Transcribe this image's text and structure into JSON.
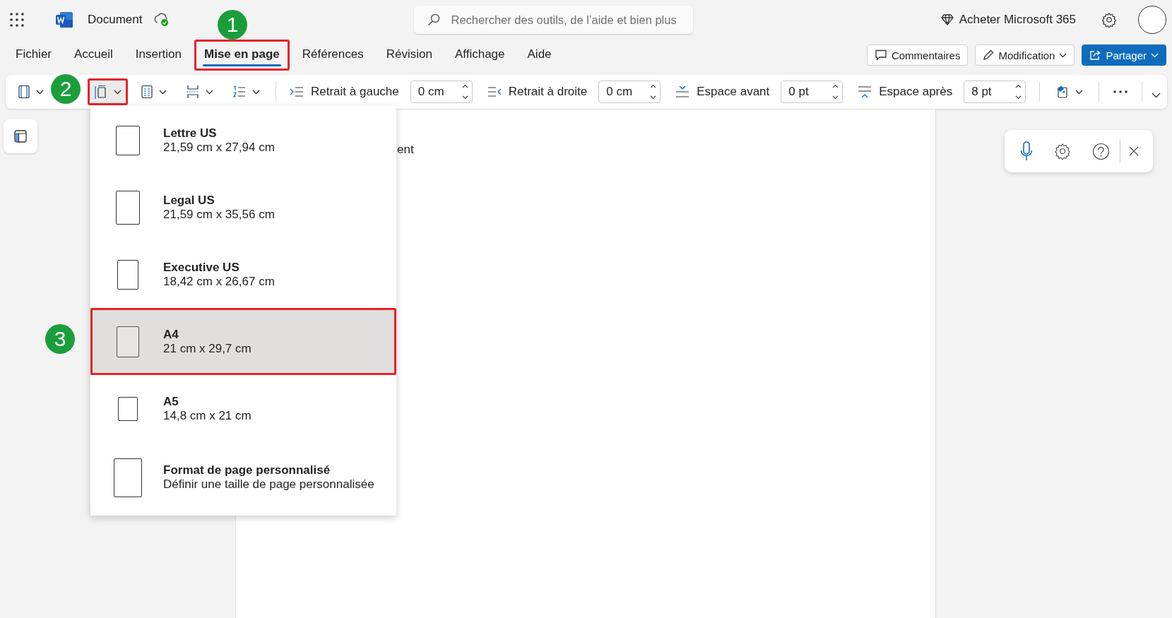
{
  "app_bar": {
    "document_title": "Document",
    "search": {
      "placeholder": "Rechercher des outils, de l’aide et bien plus"
    },
    "buy_label": "Acheter Microsoft 365"
  },
  "menu_tabs": [
    {
      "label": "Fichier",
      "selected": false,
      "outlined": false
    },
    {
      "label": "Accueil",
      "selected": false,
      "outlined": false
    },
    {
      "label": "Insertion",
      "selected": false,
      "outlined": false
    },
    {
      "label": "Mise en page",
      "selected": true,
      "outlined": true
    },
    {
      "label": "Références",
      "selected": false,
      "outlined": false
    },
    {
      "label": "Révision",
      "selected": false,
      "outlined": false
    },
    {
      "label": "Affichage",
      "selected": false,
      "outlined": false
    },
    {
      "label": "Aide",
      "selected": false,
      "outlined": false
    }
  ],
  "actions": [
    {
      "label": "Commentaires",
      "kind": "comment"
    },
    {
      "label": "Modification",
      "kind": "edit"
    },
    {
      "label": "Partager",
      "kind": "share"
    }
  ],
  "toolbar": {
    "tools": [
      {
        "kind": "margins",
        "outlined": false
      },
      {
        "kind": "size",
        "outlined": true
      },
      {
        "kind": "columns",
        "outlined": false
      },
      {
        "kind": "breaks",
        "outlined": false
      },
      {
        "kind": "line-numbers",
        "outlined": false
      }
    ],
    "spacing": [
      {
        "kind": "indent-left",
        "label": "Retrait à gauche",
        "value": "0 cm"
      },
      {
        "kind": "indent-right",
        "label": "Retrait à droite",
        "value": "0 cm"
      },
      {
        "kind": "space-before",
        "label": "Espace avant",
        "value": "0 pt"
      },
      {
        "kind": "space-after",
        "label": "Espace après",
        "value": "8 pt"
      }
    ]
  },
  "document": {
    "visible_text": "ent"
  },
  "page_sizes": [
    {
      "kind": "letter",
      "name": "Lettre US",
      "dimensions": "21,59 cm x 27,94 cm",
      "selected": false,
      "outlined": false
    },
    {
      "kind": "legal",
      "name": "Legal US",
      "dimensions": "21,59 cm x 35,56 cm",
      "selected": false,
      "outlined": false
    },
    {
      "kind": "executive",
      "name": "Executive US",
      "dimensions": "18,42 cm x 26,67 cm",
      "selected": false,
      "outlined": false
    },
    {
      "kind": "a4",
      "name": "A4",
      "dimensions": "21 cm x 29,7 cm",
      "selected": true,
      "outlined": true
    },
    {
      "kind": "a5",
      "name": "A5",
      "dimensions": "14,8 cm x 21 cm",
      "selected": false,
      "outlined": false
    },
    {
      "kind": "custom",
      "name": "Format de page personnalisé",
      "dimensions": "Définir une taille de page personnalisée",
      "selected": false,
      "outlined": false
    }
  ],
  "callouts": [
    {
      "number": "1"
    },
    {
      "number": "2"
    },
    {
      "number": "3"
    }
  ]
}
